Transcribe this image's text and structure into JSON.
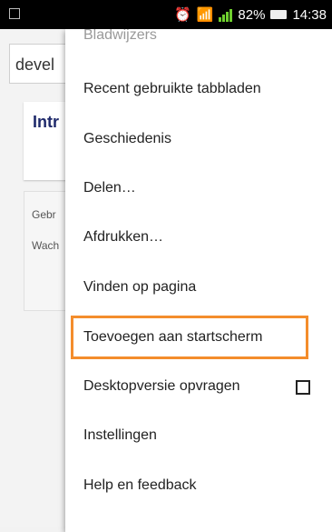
{
  "status_bar": {
    "battery": "82%",
    "time": "14:38"
  },
  "page": {
    "url_text": "devel",
    "card_title": "Intr",
    "field_1": "Gebr",
    "field_2": "Wach"
  },
  "menu": {
    "items": [
      {
        "label": "Bladwijzers"
      },
      {
        "label": "Recent gebruikte tabbladen"
      },
      {
        "label": "Geschiedenis"
      },
      {
        "label": "Delen…"
      },
      {
        "label": "Afdrukken…"
      },
      {
        "label": "Vinden op pagina"
      },
      {
        "label": "Toevoegen aan startscherm"
      },
      {
        "label": "Desktopversie opvragen",
        "checked": false
      },
      {
        "label": "Instellingen"
      },
      {
        "label": "Help en feedback"
      }
    ],
    "highlight_color": "#f48d2c"
  }
}
